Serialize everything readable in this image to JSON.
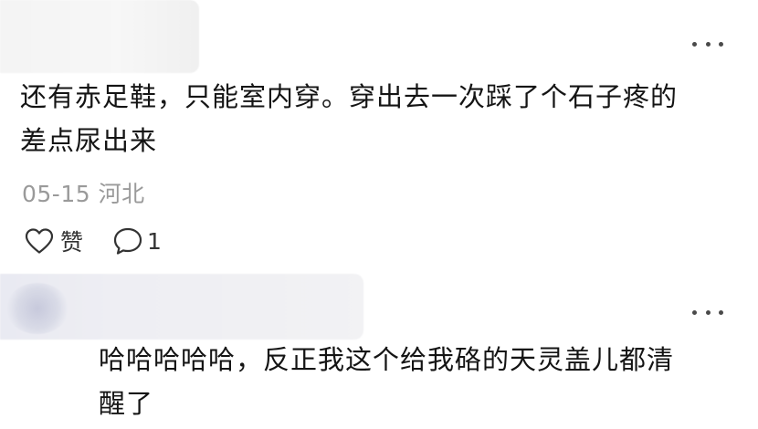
{
  "comments": [
    {
      "text_line1": "还有赤足鞋，只能室内穿。穿出去一次踩了个石子疼的",
      "text_line2": "差点尿出来",
      "date": "05-15",
      "location": "河北",
      "like_label": "赞",
      "reply_count": "1",
      "icons": [
        "heart-icon",
        "comment-bubble-icon",
        "more-dots-icon"
      ]
    },
    {
      "text_line1": "哈哈哈哈哈，反正我这个给我硌的天灵盖儿都清",
      "text_line2": "醒了",
      "icons": [
        "more-dots-icon"
      ]
    }
  ]
}
